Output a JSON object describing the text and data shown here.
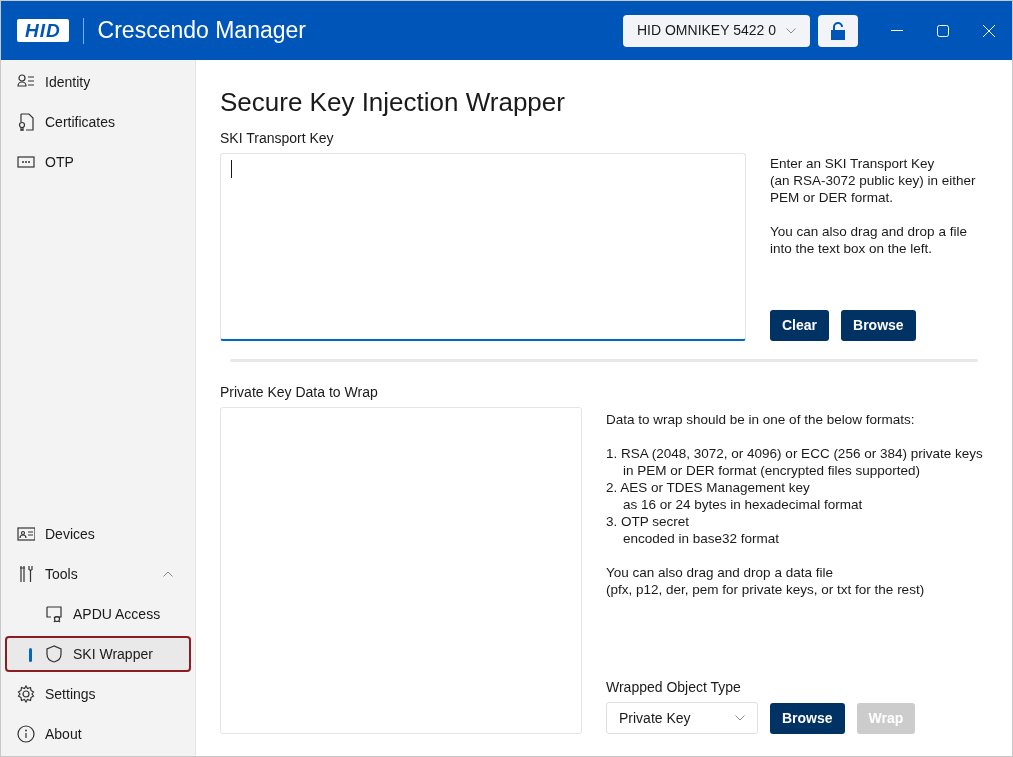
{
  "window": {
    "logo": "HID",
    "title": "Crescendo Manager",
    "device_select": "HID OMNIKEY 5422 0"
  },
  "sidebar": {
    "top_items": [
      {
        "kind": "identity",
        "label": "Identity",
        "selected": false
      },
      {
        "kind": "certificate",
        "label": "Certificates",
        "selected": false
      },
      {
        "kind": "otp",
        "label": "OTP",
        "selected": false
      }
    ],
    "bottom_items": [
      {
        "kind": "devices",
        "label": "Devices",
        "selected": false
      },
      {
        "kind": "tools",
        "label": "Tools",
        "selected": false,
        "expanded": true,
        "children": [
          {
            "kind": "apdu",
            "label": "APDU Access",
            "selected": false
          },
          {
            "kind": "shield",
            "label": "SKI Wrapper",
            "selected": true
          }
        ]
      },
      {
        "kind": "settings",
        "label": "Settings",
        "selected": false
      },
      {
        "kind": "about",
        "label": "About",
        "selected": false
      }
    ]
  },
  "page": {
    "title": "Secure Key Injection Wrapper",
    "transport_key": {
      "label": "SKI Transport Key",
      "focused": true,
      "help": [
        "Enter an SKI Transport Key\n(an RSA-3072 public key) in either\nPEM or DER format.",
        "You can also drag and drop a file\ninto the text box on the left."
      ],
      "buttons": [
        {
          "label": "Clear",
          "disabled": false
        },
        {
          "label": "Browse",
          "disabled": false
        }
      ]
    },
    "private_key": {
      "label": "Private Key Data to Wrap",
      "focused": false,
      "help_heading": "Data to wrap should be in one of the below formats:",
      "formats": [
        "1. RSA (2048, 3072, or 4096) or ECC (256 or 384) private keys\nin PEM or DER format (encrypted files supported)",
        "2. AES or TDES Management key\nas 16 or 24 bytes in hexadecimal format",
        "3. OTP secret\nencoded in base32 format"
      ],
      "note": "You can also drag and drop a data file\n(pfx, p12, der, pem for private keys, or txt for the rest)",
      "object_type_label": "Wrapped Object Type",
      "object_type": "Private Key",
      "buttons": [
        {
          "label": "Browse",
          "disabled": false
        },
        {
          "label": "Wrap",
          "disabled": true
        }
      ]
    }
  }
}
